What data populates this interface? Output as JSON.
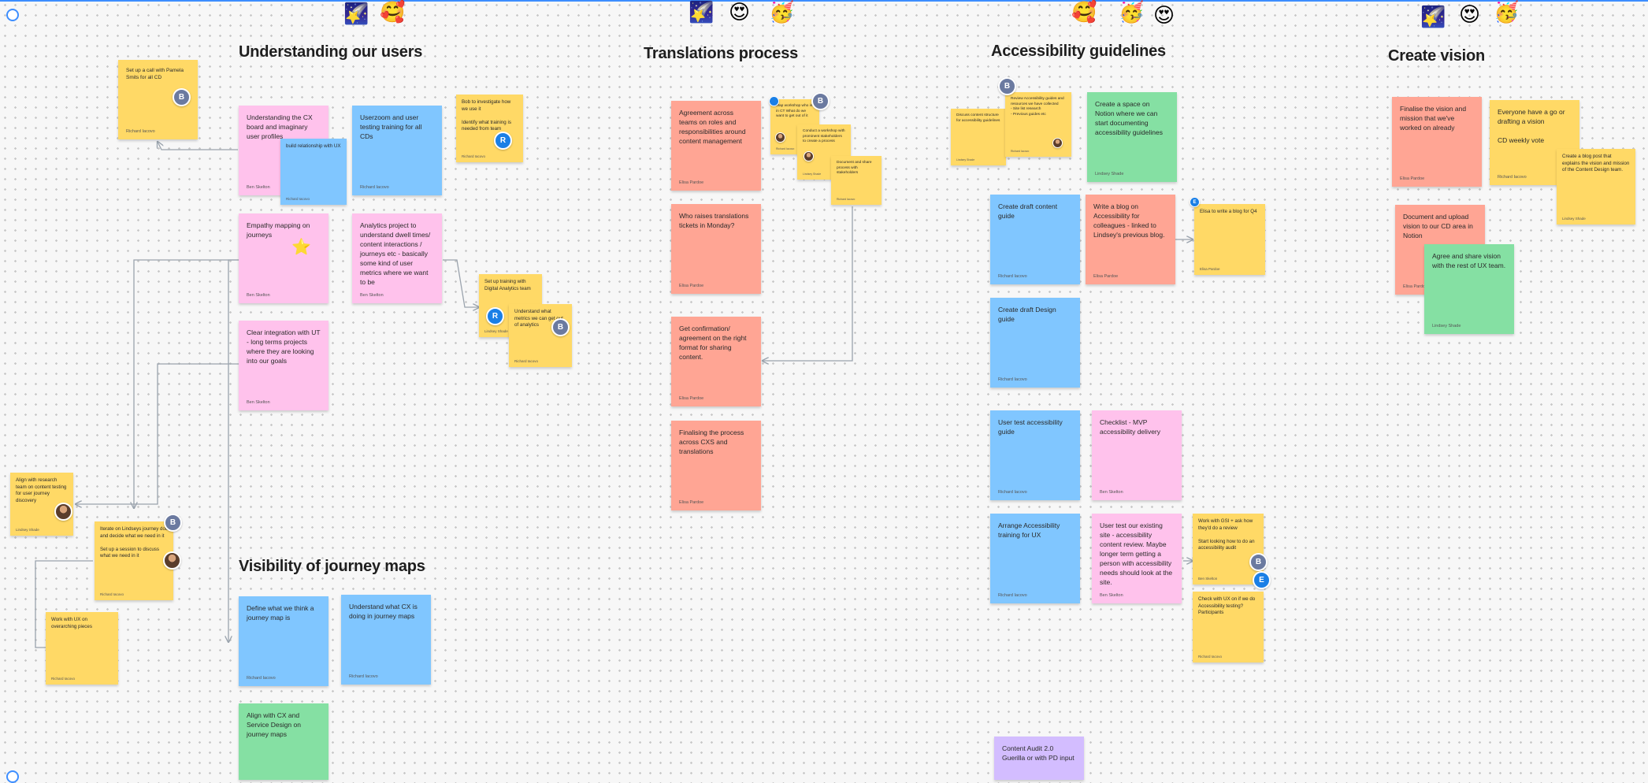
{
  "sections": {
    "users": "Understanding our users",
    "translations": "Translations process",
    "accessibility": "Accessibility guidelines",
    "vision": "Create vision",
    "journey": "Visibility of journey maps"
  },
  "stickers": {
    "g1": [
      "🌠",
      "🥰"
    ],
    "g2": [
      "🌠",
      "😍",
      "🥳"
    ],
    "g3": [
      "🥰",
      "🥳",
      "😍"
    ],
    "g4": [
      "🌠",
      "😍",
      "🥳"
    ]
  },
  "notes": {
    "pamela": {
      "text": "Set up a call with Pamela Smits for all CD",
      "author": "Richard Iacovo",
      "avatar": "B"
    },
    "cx_board": {
      "text": "Understanding the CX board and imaginary user profiles",
      "author": "Ben Skelton"
    },
    "build_rel": {
      "text": "build relationship with UX",
      "author": "Richard Iacovo"
    },
    "userzoom": {
      "text": "Userzoom and user testing training for all CDs",
      "author": "Richard Iacovo"
    },
    "investigate": {
      "text": "Bob to investigate how we use it\n\nIdentify what training is needed from team",
      "author": "Richard Iacovo",
      "avatar": "R"
    },
    "empathy": {
      "text": "Empathy mapping on journeys",
      "author": "Ben Skelton",
      "sticker": "⭐"
    },
    "analytics": {
      "text": "Analytics project to understand dwell times/ content interactions / journeys etc - basically some kind of user metrics where we want to be",
      "author": "Ben Skelton"
    },
    "ga_team": {
      "text": "Set up training with Digital Analytics team",
      "author": "Lindsey Shade",
      "avatar": "R"
    },
    "ga_get_out": {
      "text": "Understand what metrics we can get out of analytics",
      "author": "Richard Iacovo",
      "avatar": "B"
    },
    "clear_int": {
      "text": "Clear integration with UT - long terms projects where they are looking into our goals",
      "author": "Ben Skelton"
    },
    "research": {
      "text": "Align with research team on content testing for user journey discovery",
      "author": "Lindsey Shade"
    },
    "iterate": {
      "text": "Iterate on Lindseys journey doc and decide what we need in it\n\nSet up a session to discuss what we need in it",
      "author": "Richard Iacovo",
      "avatar": "B"
    },
    "work_ux": {
      "text": "Work with UX on overarching pieces",
      "author": "Richard Iacovo"
    },
    "agreement": {
      "text": "Agreement across teams on roles and responsibilities around content management",
      "author": "Elisa Pardoe"
    },
    "who_raises": {
      "text": "Who raises translations tickets in Monday?",
      "author": "Elisa Pardoe"
    },
    "confirm": {
      "text": "Get confirmation/ agreement on the right format for sharing content.",
      "author": "Elisa Pardoe"
    },
    "finalising": {
      "text": "Finalising the process across CXS and translations",
      "author": "Elisa Pardoe"
    },
    "t_small1": {
      "text": "Map workshop who is in CT What do we want to get out of it",
      "author": "Richard Iacovo",
      "avatar": "B"
    },
    "t_small2": {
      "text": "Conduct a workshop with prominent stakeholders to create a process",
      "author": "Lindsey Shade"
    },
    "t_small3": {
      "text": "Document and share process with stakeholders",
      "author": "Richard Iacovo"
    },
    "a_small1": {
      "text": "Discuss content structure for accessibility guidelines",
      "author": "Lindsey Shade"
    },
    "a_small2": {
      "text": "Review Accessibility guides and resources we have collected\n - Site list research\n - Previous guides etc",
      "author": "Richard Iacovo",
      "avatar": "B"
    },
    "notion_space": {
      "text": "Create a space on Notion where we can start documenting accessibility guidelines",
      "author": "Lindsey Shade"
    },
    "draft_content": {
      "text": "Create draft content guide",
      "author": "Richard Iacovo"
    },
    "blog": {
      "text": "Write a blog on Accessibility for colleagues - linked to Lindsey's previous blog.",
      "author": "Elisa Pardoe"
    },
    "blog_q4": {
      "text": "Elisa to write a blog for Q4",
      "author": "Elisa Pardoe",
      "avatar": "E"
    },
    "draft_design": {
      "text": "Create draft Design guide",
      "author": "Richard Iacovo"
    },
    "user_test_guide": {
      "text": "User test accessibility guide",
      "author": "Richard Iacovo"
    },
    "checklist": {
      "text": "Checklist - MVP accessibility delivery",
      "author": "Ben Skelton"
    },
    "arrange": {
      "text": "Arrange Accessibility training for UX",
      "author": "Richard Iacovo"
    },
    "user_test_site": {
      "text": "User test our existing site - accessibility content review. Maybe longer term getting a person with accessibility needs should look at the site.",
      "author": "Ben Skelton"
    },
    "work_gsi": {
      "text": "Work with GSI + ask how they'd do a review\n\nStart looking how to do an accessibility audit",
      "author": "Ben Skelton",
      "avatar": "B"
    },
    "check_ux": {
      "text": "Check with UX on if we do Accessibility testing? Participants",
      "author": "Richard Iacovo",
      "avatar": "E"
    },
    "audit": {
      "text": "Content Audit 2.0\nGuerilla or with PD input",
      "author": ""
    },
    "finalise_vision": {
      "text": "Finalise the vision and mission that we've worked on already",
      "author": "Elisa Pardoe"
    },
    "everyone_go": {
      "text": "Everyone have a go or drafting a vision\n\nCD weekly vote",
      "author": "Richard Iacovo"
    },
    "blog_post": {
      "text": "Create a blog post that explains the vision and mission of the Content Design team.",
      "author": "Lindsey Shade"
    },
    "document_upload": {
      "text": "Document and upload vision to our CD area in Notion",
      "author": "Elisa Pardoe"
    },
    "agree_share": {
      "text": "Agree and share vision with the rest of UX team.",
      "author": "Lindsey Shade"
    },
    "define_journey": {
      "text": "Define what we think a journey map is",
      "author": "Richard Iacovo"
    },
    "understand_cx": {
      "text": "Understand what CX is doing in journey maps",
      "author": "Richard Iacovo"
    },
    "align_cx": {
      "text": "Align with CX and Service Design on journey maps",
      "author": ""
    }
  },
  "colors": {
    "selection": "#3d8eff",
    "yellow": "#ffd966",
    "salmon": "#ffa594",
    "blue": "#80c6ff",
    "pink": "#ffc2ec",
    "green": "#85e0a3",
    "violet": "#d3bdff"
  }
}
